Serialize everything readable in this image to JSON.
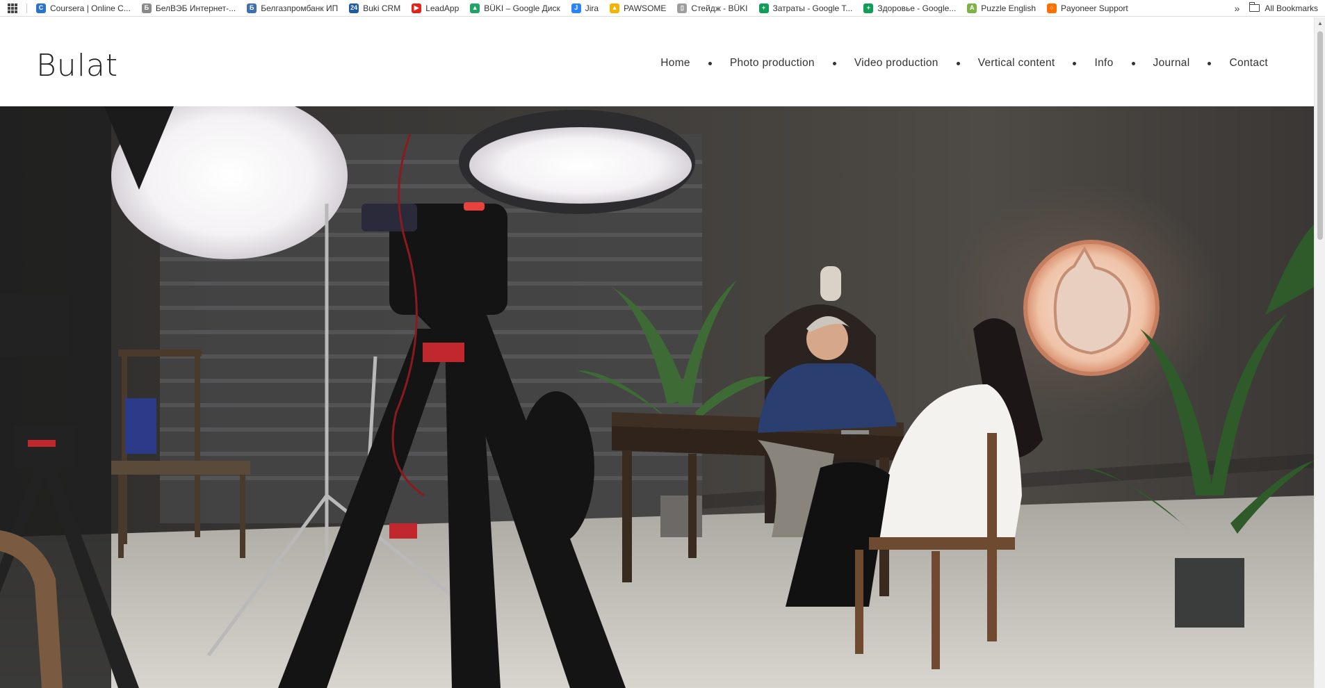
{
  "bookmarks_bar": {
    "items": [
      {
        "label": "Coursera | Online C...",
        "icon": "coursera-icon",
        "color": "#2a73cc",
        "glyph": "C"
      },
      {
        "label": "БелВЭБ Интернет-...",
        "icon": "belveb-icon",
        "color": "#8a8a8a",
        "glyph": "Б"
      },
      {
        "label": "Белгазпромбанк ИП",
        "icon": "belgazprombank-icon",
        "color": "#3d6fb5",
        "glyph": "Б"
      },
      {
        "label": "Buki CRM",
        "icon": "bitrix24-icon",
        "color": "#1e5aa8",
        "glyph": "24"
      },
      {
        "label": "LeadApp",
        "icon": "youtube-icon",
        "color": "#e62117",
        "glyph": "▶"
      },
      {
        "label": "BÜKI – Google Диск",
        "icon": "google-drive-icon",
        "color": "#1fa463",
        "glyph": "▲"
      },
      {
        "label": "Jira",
        "icon": "jira-icon",
        "color": "#2684ff",
        "glyph": "J"
      },
      {
        "label": "PAWSOME",
        "icon": "google-drive-icon",
        "color": "#f4b400",
        "glyph": "▲"
      },
      {
        "label": "Стейдж - BÜKI",
        "icon": "document-icon",
        "color": "#9e9e9e",
        "glyph": "▯"
      },
      {
        "label": "Затраты - Google T...",
        "icon": "google-sheets-icon",
        "color": "#0f9d58",
        "glyph": "+"
      },
      {
        "label": "Здоровье - Google...",
        "icon": "google-sheets-icon",
        "color": "#0f9d58",
        "glyph": "+"
      },
      {
        "label": "Puzzle English",
        "icon": "puzzle-english-icon",
        "color": "#7cb342",
        "glyph": "A"
      },
      {
        "label": "Payoneer Support",
        "icon": "payoneer-icon",
        "color": "#ff6f00",
        "glyph": "○"
      }
    ],
    "more": "»",
    "all_bookmarks": "All Bookmarks"
  },
  "site": {
    "logo": "Bulat",
    "nav": [
      "Home",
      "Photo production",
      "Video production",
      "Vertical content",
      "Info",
      "Journal",
      "Contact"
    ]
  },
  "hero": {
    "alt": "Studio scene with lights, cameras and an interview at a desk"
  },
  "colors": {
    "accent_red": "#c0282d",
    "wall": "#3c3a37",
    "floor": "#cfccc6",
    "sign_glow": "#f3c1a2"
  }
}
